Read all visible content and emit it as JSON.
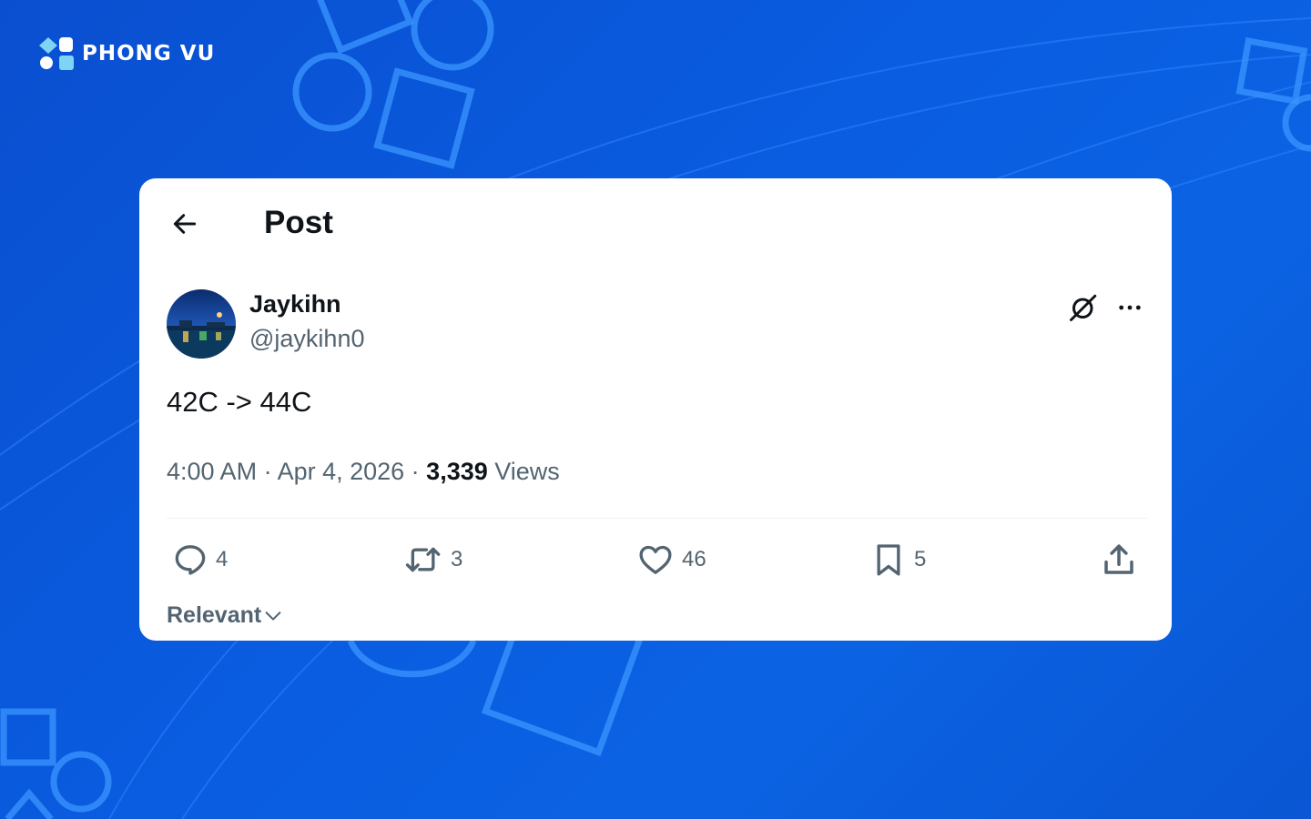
{
  "brand": {
    "name": "PHONG VU"
  },
  "post_view": {
    "title": "Post",
    "author": {
      "display_name": "Jaykihn",
      "handle": "@jaykihn0"
    },
    "text": "42C -> 44C",
    "timestamp": "4:00 AM · Apr 4, 2026 · ",
    "views_count": "3,339",
    "views_label": " Views",
    "actions": {
      "replies": "4",
      "reposts": "3",
      "likes": "46",
      "bookmarks": "5"
    },
    "sort": {
      "label": "Relevant"
    }
  },
  "icons": {
    "back": "arrow-left-icon",
    "grok": "grok-icon",
    "more": "ellipsis-icon",
    "reply": "speech-bubble-icon",
    "repost": "repost-arrows-icon",
    "like": "heart-icon",
    "bookmark": "bookmark-icon",
    "share": "share-upload-icon",
    "sort": "chevron-down-icon"
  },
  "colors": {
    "background": "#0b5ce0",
    "card": "#ffffff",
    "text_primary": "#0f1419",
    "text_secondary": "#536471",
    "divider": "#eff3f4"
  }
}
